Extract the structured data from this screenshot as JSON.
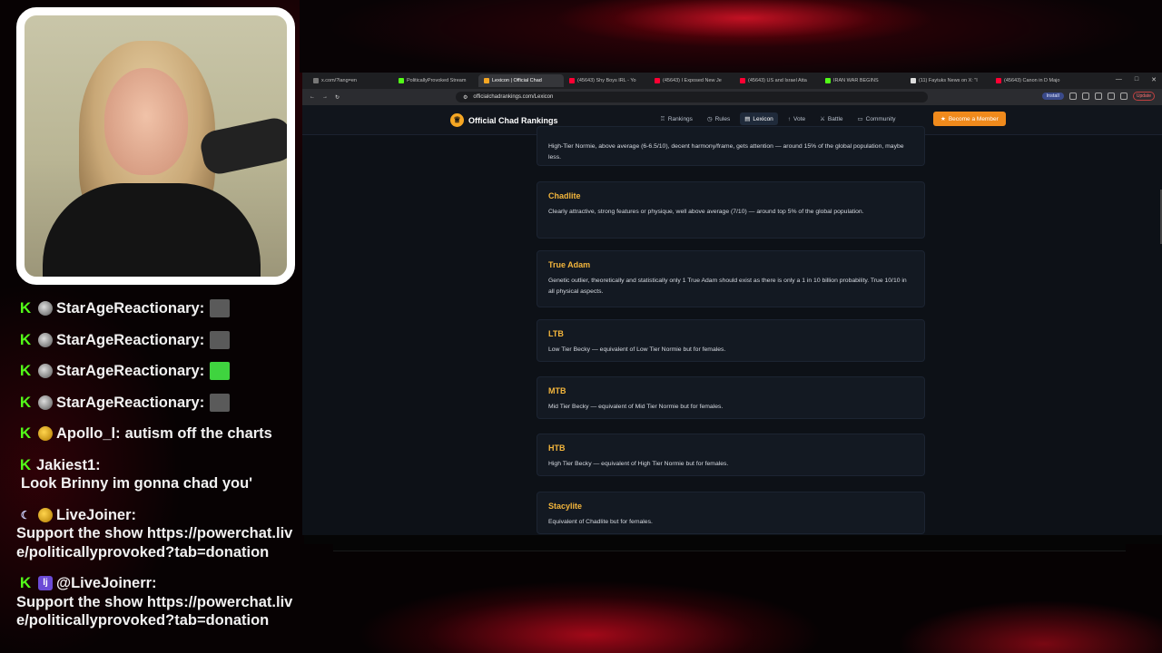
{
  "chat": [
    {
      "badges": [
        "kick",
        "dot"
      ],
      "user": "StarAgeReactionary:",
      "message": "",
      "emote": "grey"
    },
    {
      "badges": [
        "kick",
        "dot"
      ],
      "user": "StarAgeReactionary:",
      "message": "",
      "emote": "grey"
    },
    {
      "badges": [
        "kick",
        "dot"
      ],
      "user": "StarAgeReactionary:",
      "message": "",
      "emote": "green"
    },
    {
      "badges": [
        "kick",
        "dot"
      ],
      "user": "StarAgeReactionary:",
      "message": "",
      "emote": "grey"
    },
    {
      "badges": [
        "kick",
        "sub"
      ],
      "user": "Apollo_l:",
      "message": "autism off the charts",
      "emote": ""
    },
    {
      "badges": [
        "kick"
      ],
      "user": "Jakiest1:",
      "message": "Look Brinny im gonna chad you'",
      "emote": ""
    },
    {
      "badges": [
        "moon",
        "sub"
      ],
      "user": "LiveJoiner:",
      "message": "Support the show https://powerchat.live/politicallyprovoked?tab=donation",
      "emote": ""
    },
    {
      "badges": [
        "kick",
        "lj"
      ],
      "user": "@LiveJoinerr:",
      "message": "Support the show https://powerchat.live/politicallyprovoked?tab=donation",
      "emote": ""
    }
  ],
  "browser": {
    "tabs": [
      {
        "label": "x.com/?lang=en",
        "color": "#777"
      },
      {
        "label": "PoliticallyProvoked Stream",
        "color": "#53fc18"
      },
      {
        "label": "Lexicon | Official Chad",
        "color": "#f5a623",
        "active": true
      },
      {
        "label": "(45643) Shy Boys IRL - Yo",
        "color": "#ff0033"
      },
      {
        "label": "(45643) I Exposed New Je",
        "color": "#ff0033"
      },
      {
        "label": "(45643) US and Israel Atta",
        "color": "#ff0033"
      },
      {
        "label": "IRAN WAR BEGINS",
        "color": "#53fc18"
      },
      {
        "label": "(11) Faytuks News on X: \"I",
        "color": "#ddd"
      },
      {
        "label": "(45643) Canon in D Majo",
        "color": "#ff0033"
      }
    ],
    "url": "officialchadrankings.com/Lexicon",
    "install_label": "Install",
    "update_label": "Update"
  },
  "site": {
    "brand": "Official Chad Rankings",
    "nav": [
      {
        "label": "Rankings",
        "icon": "trophy-icon"
      },
      {
        "label": "Rules",
        "icon": "clock-icon"
      },
      {
        "label": "Lexicon",
        "icon": "book-icon",
        "active": true
      },
      {
        "label": "Vote",
        "icon": "thumbs-up-icon"
      },
      {
        "label": "Battle",
        "icon": "swords-icon"
      },
      {
        "label": "Community",
        "icon": "chat-icon"
      }
    ],
    "member_button": "Become a Member"
  },
  "entries": [
    {
      "title": "",
      "desc": "High-Tier Normie, above average (6-6.5/10), decent harmony/frame, gets attention — around 15% of the global population, maybe less."
    },
    {
      "title": "Chadlite",
      "desc": "Clearly attractive, strong features or physique, well above average (7/10) — around top 5% of the global population."
    },
    {
      "title": "True Adam",
      "desc": "Genetic outlier, theoretically and statistically only 1 True Adam should exist as there is only a 1 in 10 billion probability. True 10/10 in all physical aspects."
    },
    {
      "title": "LTB",
      "desc": "Low Tier Becky — equivalent of Low Tier Normie but for females."
    },
    {
      "title": "MTB",
      "desc": "Mid Tier Becky — equivalent of Mid Tier Normie but for females."
    },
    {
      "title": "HTB",
      "desc": "High Tier Becky — equivalent of High Tier Normie but for females."
    },
    {
      "title": "Stacylite",
      "desc": "Equivalent of Chadlite but for females."
    }
  ]
}
